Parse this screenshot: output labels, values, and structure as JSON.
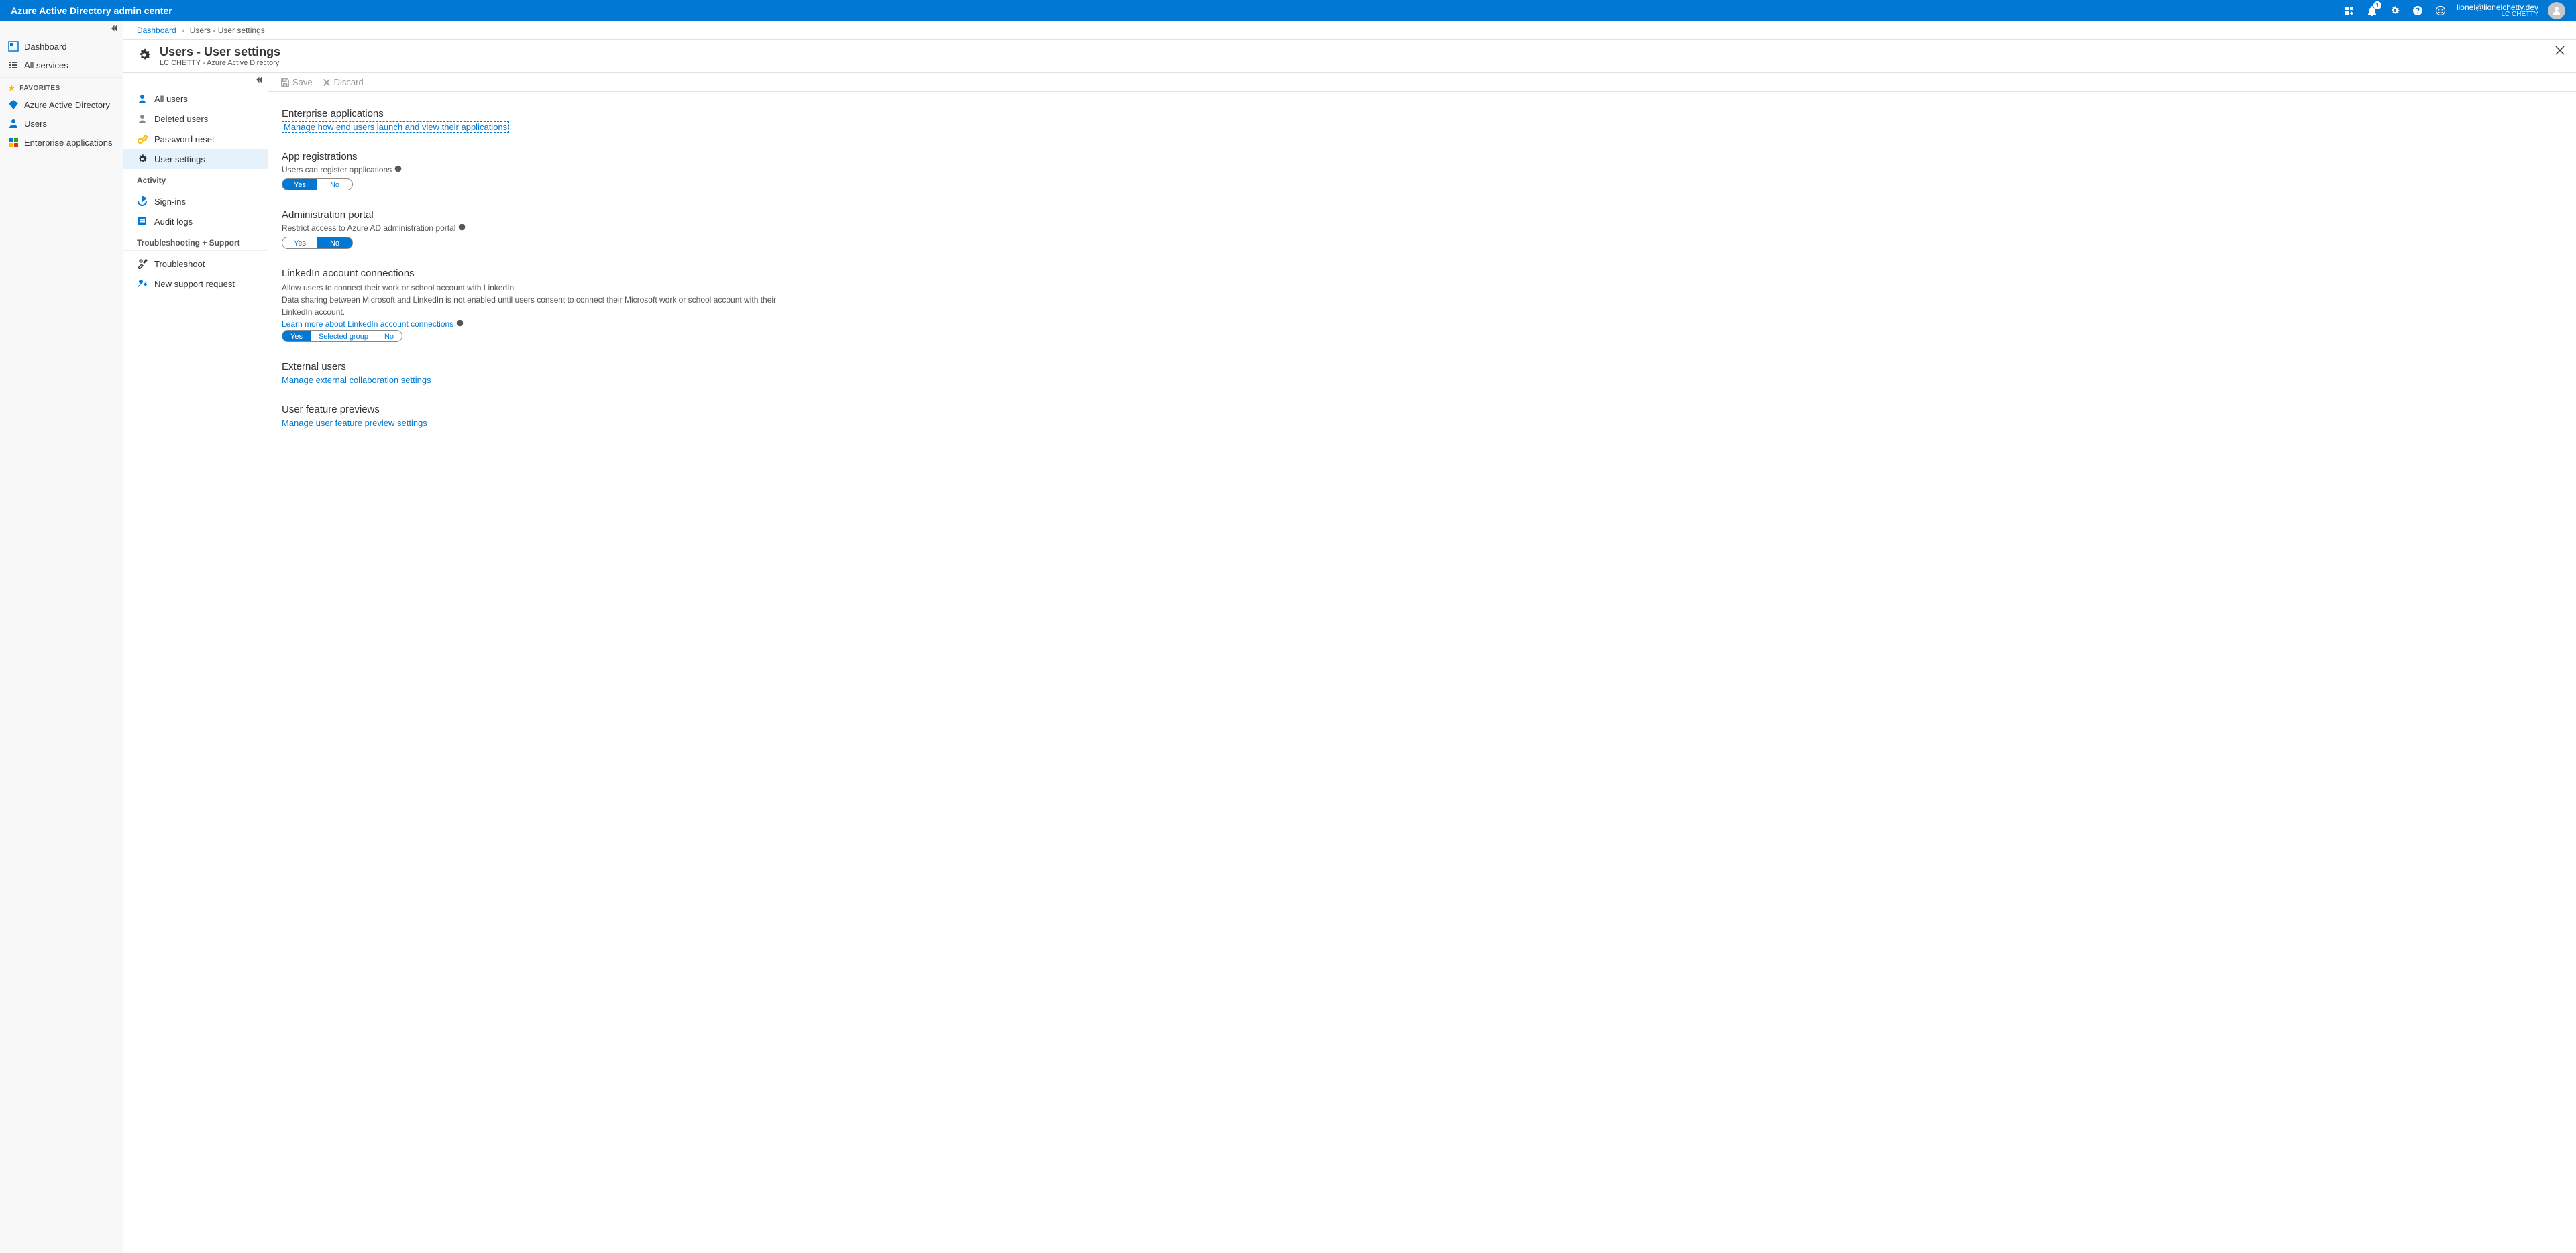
{
  "header": {
    "brand": "Azure Active Directory admin center",
    "notifications": "1",
    "user_email": "lionel@lionelchetty.dev",
    "user_org": "LC CHETTY"
  },
  "nav1": {
    "dashboard": "Dashboard",
    "all_services": "All services",
    "favorites_heading": "FAVORITES",
    "aad": "Azure Active Directory",
    "users": "Users",
    "ent_apps": "Enterprise applications"
  },
  "breadcrumb": {
    "dashboard": "Dashboard",
    "current": "Users - User settings"
  },
  "blade": {
    "title": "Users - User settings",
    "subtitle": "LC CHETTY - Azure Active Directory"
  },
  "nav2": {
    "all_users": "All users",
    "deleted_users": "Deleted users",
    "password_reset": "Password reset",
    "user_settings": "User settings",
    "activity_heading": "Activity",
    "sign_ins": "Sign-ins",
    "audit_logs": "Audit logs",
    "trouble_heading": "Troubleshooting + Support",
    "troubleshoot": "Troubleshoot",
    "new_support": "New support request"
  },
  "toolbar": {
    "save": "Save",
    "discard": "Discard"
  },
  "sections": {
    "ent_apps": {
      "title": "Enterprise applications",
      "link": "Manage how end users launch and view their applications"
    },
    "app_reg": {
      "title": "App registrations",
      "sublabel": "Users can register applications",
      "yes": "Yes",
      "no": "No"
    },
    "admin_portal": {
      "title": "Administration portal",
      "sublabel": "Restrict access to Azure AD administration portal",
      "yes": "Yes",
      "no": "No"
    },
    "linkedin": {
      "title": "LinkedIn account connections",
      "desc1": "Allow users to connect their work or school account with LinkedIn.",
      "desc2": "Data sharing between Microsoft and LinkedIn is not enabled until users consent to connect their Microsoft work or school account with their LinkedIn account.",
      "learn": "Learn more about LinkedIn account connections",
      "yes": "Yes",
      "selected_group": "Selected group",
      "no": "No"
    },
    "external": {
      "title": "External users",
      "link": "Manage external collaboration settings"
    },
    "previews": {
      "title": "User feature previews",
      "link": "Manage user feature preview settings"
    }
  }
}
